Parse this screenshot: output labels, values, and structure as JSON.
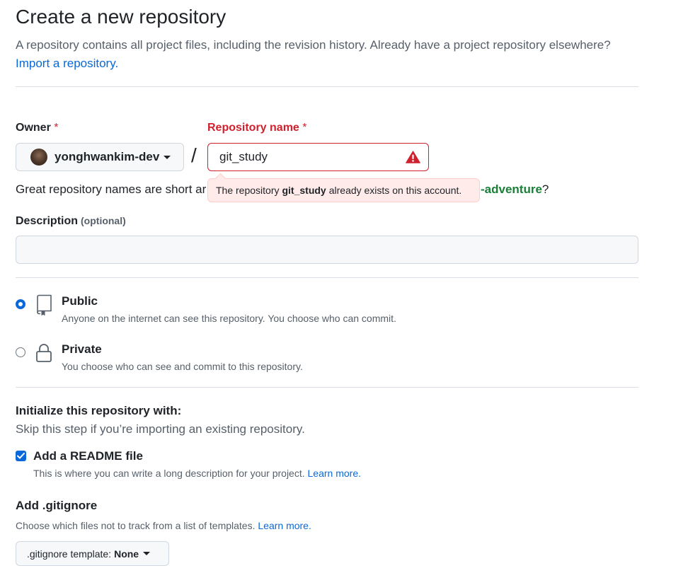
{
  "header": {
    "title": "Create a new repository",
    "subtitle": "A repository contains all project files, including the revision history. Already have a project repository elsewhere?",
    "import_link": "Import a repository."
  },
  "owner": {
    "label": "Owner",
    "required_mark": "*",
    "value": "yonghwankim-dev"
  },
  "separator": "/",
  "repo_name": {
    "label": "Repository name",
    "required_mark": "*",
    "value": "git_study",
    "error_prefix": "The repository",
    "error_name": "git_study",
    "error_suffix": "already exists on this account."
  },
  "name_hint": {
    "text": "Great repository names are short ar",
    "suggestion_tail": "-adventure",
    "suggestion_end": "?"
  },
  "description": {
    "label": "Description",
    "optional": "(optional)",
    "value": ""
  },
  "visibility": {
    "public_title": "Public",
    "public_desc": "Anyone on the internet can see this repository. You choose who can commit.",
    "private_title": "Private",
    "private_desc": "You choose who can see and commit to this repository.",
    "selected": "Public"
  },
  "initialize": {
    "title": "Initialize this repository with:",
    "subtitle": "Skip this step if you’re importing an existing repository.",
    "readme_label": "Add a README file",
    "readme_desc": "This is where you can write a long description for your project.",
    "readme_learn_more": "Learn more.",
    "readme_checked": true
  },
  "gitignore": {
    "title": "Add .gitignore",
    "desc": "Choose which files not to track from a list of templates.",
    "learn_more": "Learn more.",
    "button_prefix": ".gitignore template:",
    "button_value": "None"
  },
  "colors": {
    "accent": "#0969da",
    "danger": "#cf222e",
    "success": "#1a7f37"
  }
}
